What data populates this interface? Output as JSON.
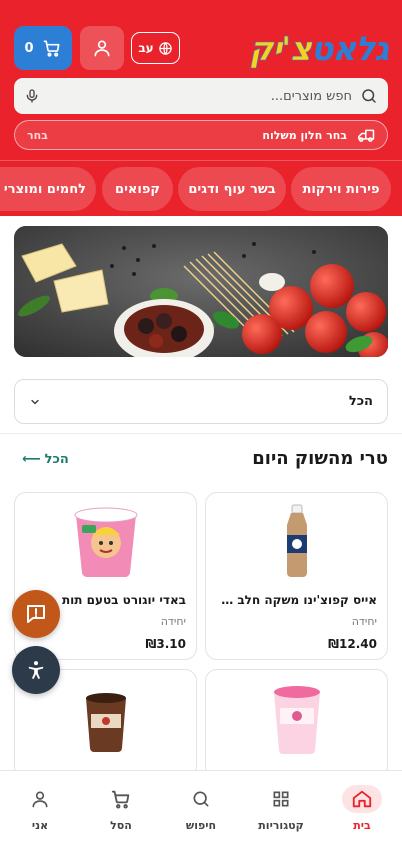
{
  "header": {
    "logo_part1": "גלאט",
    "logo_part2": "צ'יק",
    "cart_count": "0",
    "language": "עב",
    "search_placeholder": "חפש מוצרים...",
    "delivery_label": "בחר חלון משלוח",
    "delivery_action": "בחר"
  },
  "categories": [
    "פירות וירקות",
    "בשר עוף ודגים",
    "קפואים",
    "לחמים ומוצרי מא"
  ],
  "filter": {
    "selected": "הכל"
  },
  "section": {
    "title": "טרי מהשוק היום",
    "see_all": "הכל"
  },
  "products": [
    {
      "name": "אייס קפוצ'ינו משקה חלב עם...",
      "unit": "יחידה",
      "price": "12.40",
      "currency": "₪"
    },
    {
      "name": "באדי יוגורט בטעם תות",
      "unit": "יחידה",
      "price": "3.10",
      "currency": "₪"
    },
    {
      "name": "",
      "unit": "",
      "price": "",
      "currency": ""
    },
    {
      "name": "",
      "unit": "",
      "price": "",
      "currency": ""
    }
  ],
  "bottom_nav": [
    {
      "label": "בית",
      "icon": "home-icon",
      "active": true
    },
    {
      "label": "קטגוריות",
      "icon": "grid-icon",
      "active": false
    },
    {
      "label": "חיפוש",
      "icon": "search-icon",
      "active": false
    },
    {
      "label": "הסל",
      "icon": "cart-icon",
      "active": false
    },
    {
      "label": "אני",
      "icon": "user-icon",
      "active": false
    }
  ],
  "colors": {
    "brand_red": "#ea222b",
    "brand_blue": "#2c7fd4",
    "accent_green": "#1d7a6e",
    "chat_orange": "#c2571a"
  }
}
